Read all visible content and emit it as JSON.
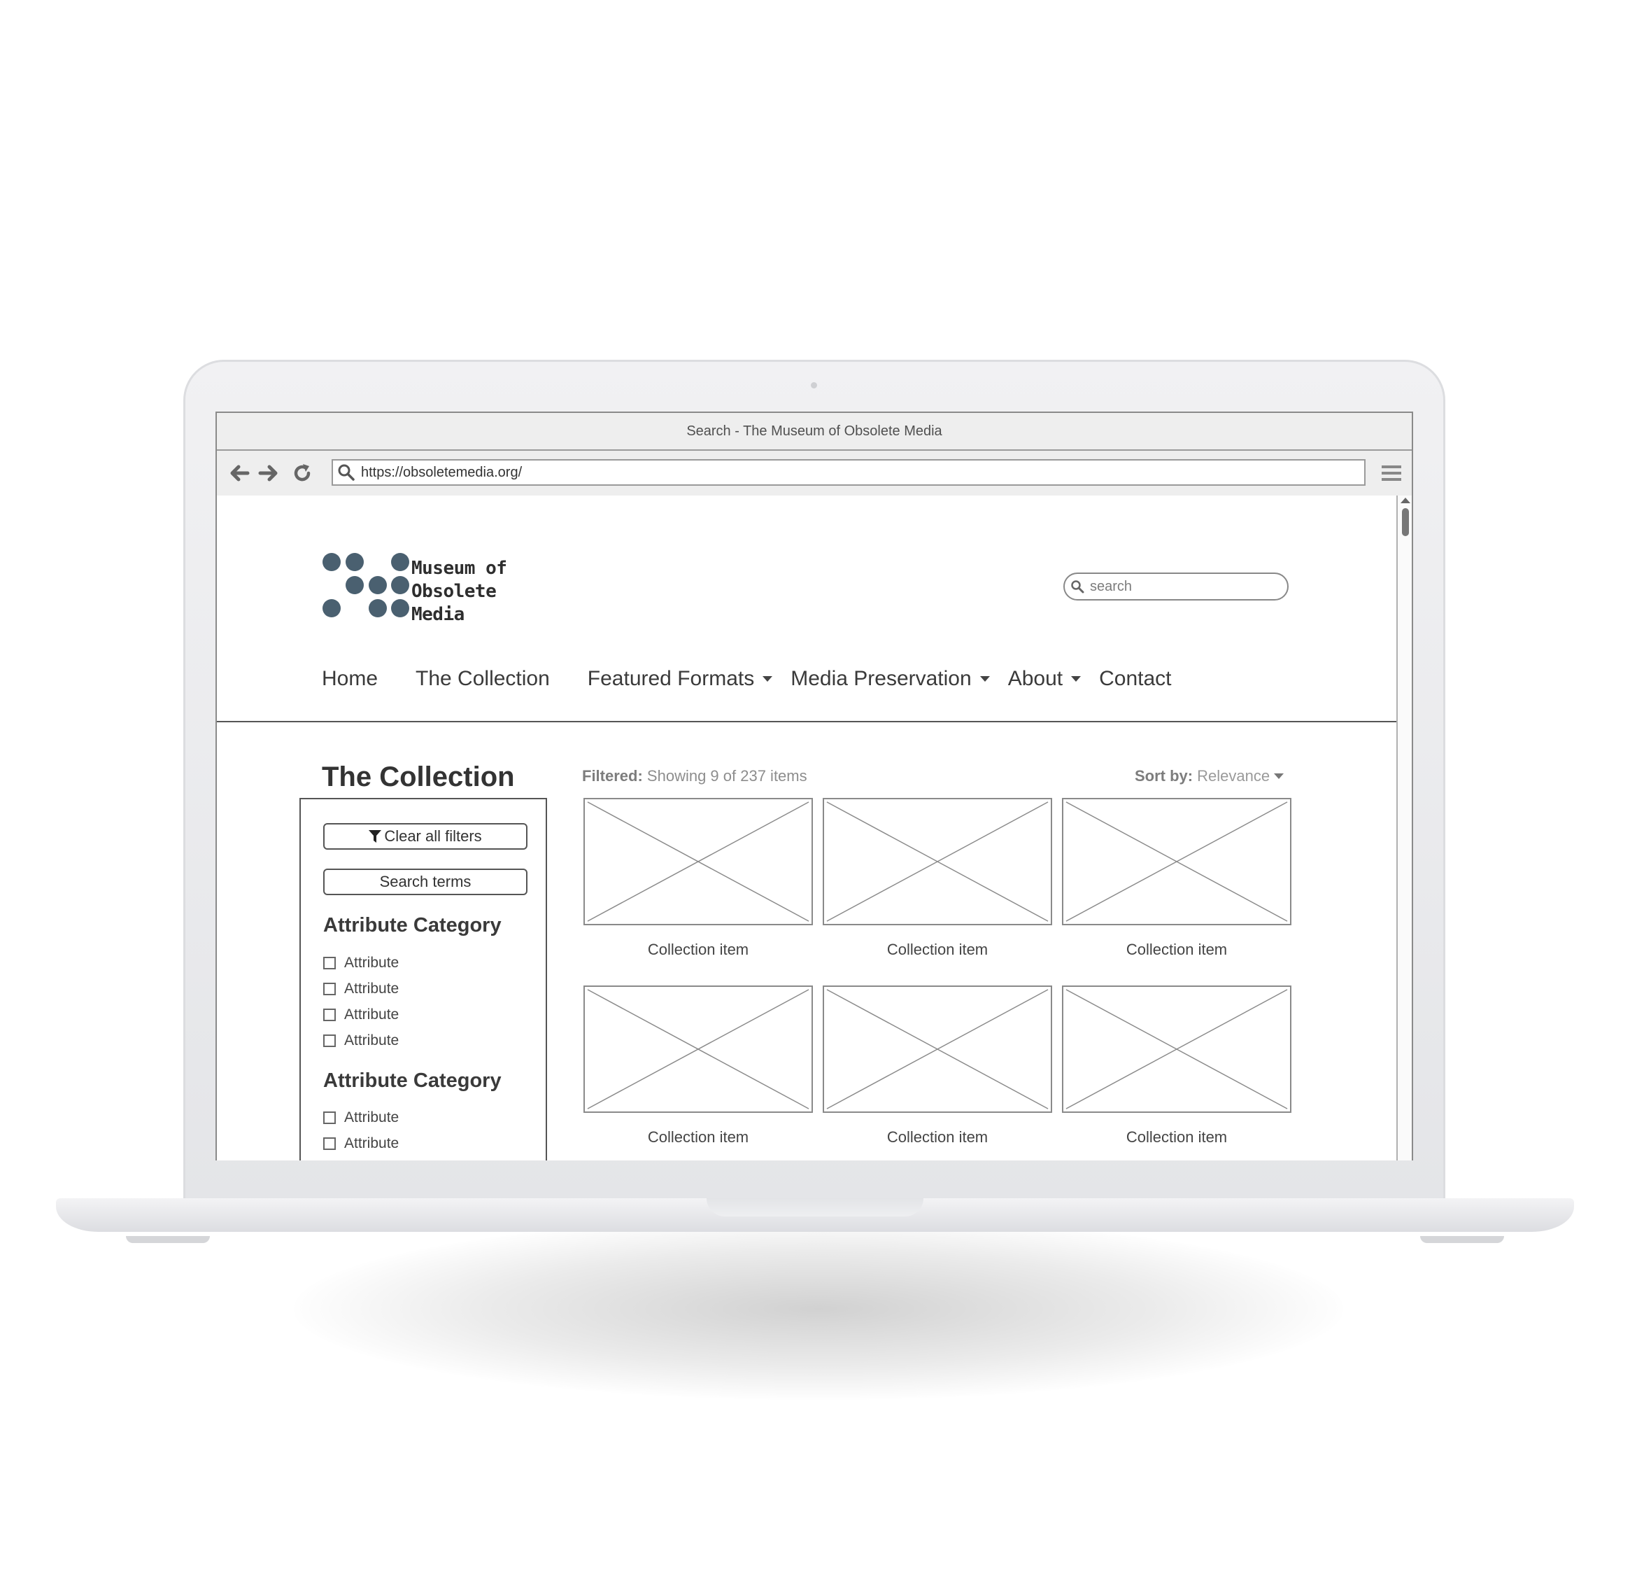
{
  "window": {
    "title": "Search - The Museum of Obsolete Media",
    "url": "https://obsoletemedia.org/"
  },
  "icons": {
    "back": "arrow-left-icon",
    "forward": "arrow-right-icon",
    "reload": "reload-icon",
    "address_search": "search-icon",
    "browser_menu": "hamburger-menu-icon",
    "site_search": "search-icon",
    "filter": "funnel-icon"
  },
  "colors": {
    "logo_dots": "#4a6070",
    "text_dark": "#333333",
    "muted": "#8d8d8d"
  },
  "site": {
    "logo_lines": [
      "Museum of",
      "Obsolete",
      "Media"
    ],
    "search_placeholder": "search"
  },
  "nav": {
    "items": [
      {
        "label": "Home"
      },
      {
        "label": "The Collection"
      },
      {
        "label": "Featured Formats"
      },
      {
        "label": "Media Preservation"
      },
      {
        "label": "About"
      },
      {
        "label": "Contact"
      }
    ]
  },
  "main": {
    "heading": "The Collection",
    "filter_label": "Filtered:",
    "filter_text": "Showing 9 of 237 items",
    "sort_label": "Sort by:",
    "sort_value": "Relevance"
  },
  "filters": {
    "clear_label": "Clear all filters",
    "search_label": "Search terms",
    "categories": [
      {
        "title": "Attribute Category",
        "attributes": [
          "Attribute",
          "Attribute",
          "Attribute",
          "Attribute"
        ]
      },
      {
        "title": "Attribute Category",
        "attributes": [
          "Attribute",
          "Attribute"
        ]
      }
    ]
  },
  "collection": {
    "items": [
      {
        "caption": "Collection item"
      },
      {
        "caption": "Collection item"
      },
      {
        "caption": "Collection item"
      },
      {
        "caption": "Collection item"
      },
      {
        "caption": "Collection item"
      },
      {
        "caption": "Collection item"
      }
    ]
  }
}
